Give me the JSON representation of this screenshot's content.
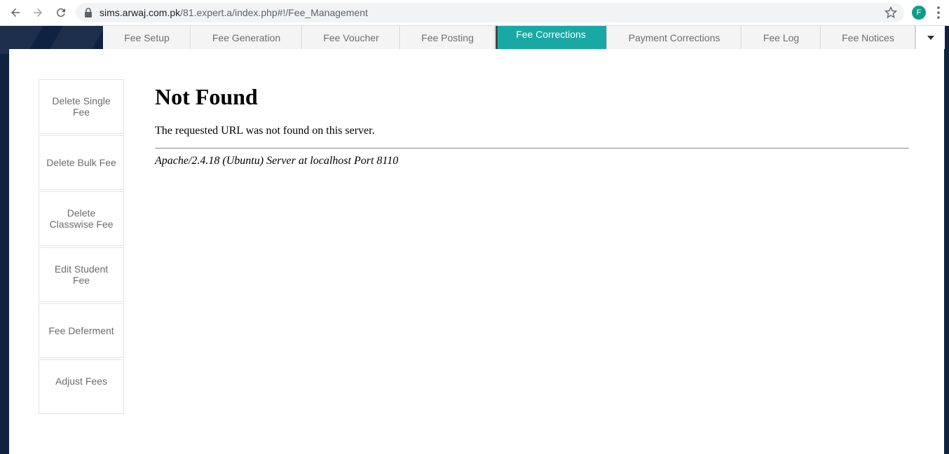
{
  "browser": {
    "url_host": "sims.arwaj.com.pk",
    "url_path": "/81.expert.a/index.php#!/Fee_Management",
    "profile_initial": "F"
  },
  "tabs": [
    {
      "label": "Fee Setup",
      "active": false
    },
    {
      "label": "Fee Generation",
      "active": false
    },
    {
      "label": "Fee Voucher",
      "active": false
    },
    {
      "label": "Fee Posting",
      "active": false
    },
    {
      "label": "Fee Corrections",
      "active": true
    },
    {
      "label": "Payment Corrections",
      "active": false
    },
    {
      "label": "Fee Log",
      "active": false
    },
    {
      "label": "Fee Notices",
      "active": false
    }
  ],
  "side_menu": [
    {
      "label": "Delete Single Fee"
    },
    {
      "label": "Delete Bulk Fee"
    },
    {
      "label": "Delete Classwise Fee"
    },
    {
      "label": "Edit Student Fee"
    },
    {
      "label": "Fee Deferment"
    },
    {
      "label": "Adjust Fees"
    }
  ],
  "error_page": {
    "title": "Not Found",
    "message": "The requested URL was not found on this server.",
    "server_signature": "Apache/2.4.18 (Ubuntu) Server at localhost Port 8110"
  },
  "colors": {
    "active_tab": "#1aa8a4",
    "background": "#0f2340",
    "avatar": "#0f9d8a"
  },
  "icons": [
    "back-arrow-icon",
    "forward-arrow-icon",
    "reload-icon",
    "lock-icon",
    "star-icon",
    "kebab-menu-icon",
    "caret-down-icon"
  ]
}
